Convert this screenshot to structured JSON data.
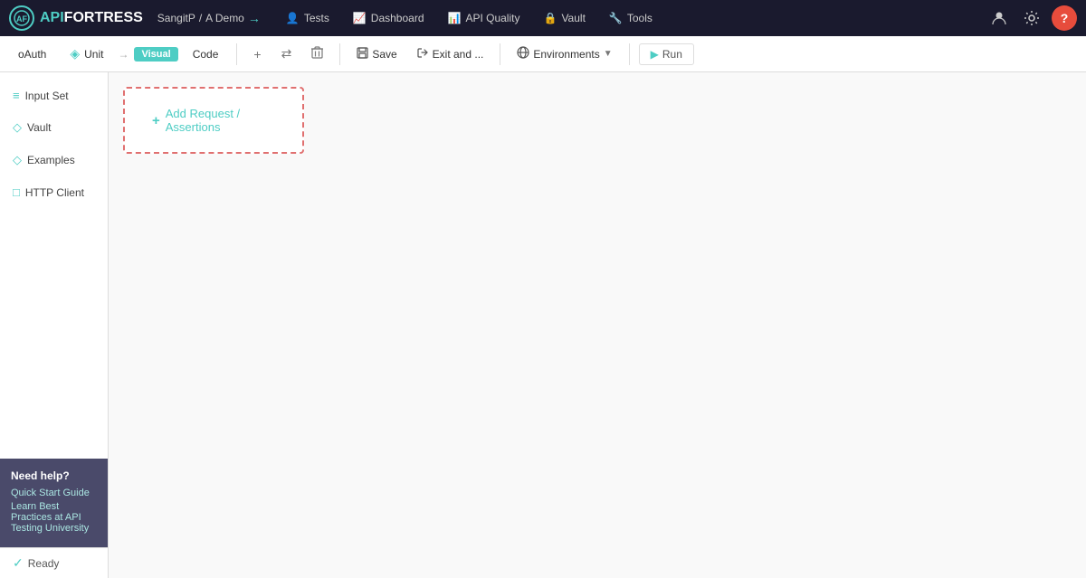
{
  "logo": {
    "icon_text": "AF",
    "api_text": "API",
    "fortress_text": "FORTRESS"
  },
  "nav": {
    "user": "SangitP",
    "project": "A Demo",
    "items": [
      {
        "label": "Tests",
        "icon": "👤"
      },
      {
        "label": "Dashboard",
        "icon": "📈"
      },
      {
        "label": "API Quality",
        "icon": "📊"
      },
      {
        "label": "Vault",
        "icon": "🔒"
      },
      {
        "label": "Tools",
        "icon": "🔧"
      }
    ]
  },
  "toolbar": {
    "tab_oauth": "oAuth",
    "tab_unit": "Unit",
    "badge_visual": "Visual",
    "tab_code": "Code",
    "btn_add": "+",
    "btn_transfer": "⇄",
    "btn_delete": "🗑",
    "btn_save": "Save",
    "btn_exit": "Exit and ...",
    "btn_environments": "Environments",
    "btn_run": "Run"
  },
  "sidebar": {
    "items": [
      {
        "label": "Input Set",
        "icon": "≡"
      },
      {
        "label": "Vault",
        "icon": "◇"
      },
      {
        "label": "Examples",
        "icon": "◇"
      },
      {
        "label": "HTTP Client",
        "icon": "□"
      }
    ],
    "help": {
      "title": "Need help?",
      "links": [
        "Quick Start Guide",
        "Learn Best Practices at API Testing University"
      ]
    },
    "status": "Ready"
  },
  "content": {
    "add_button_label": "+ Add Request / Assertions"
  }
}
